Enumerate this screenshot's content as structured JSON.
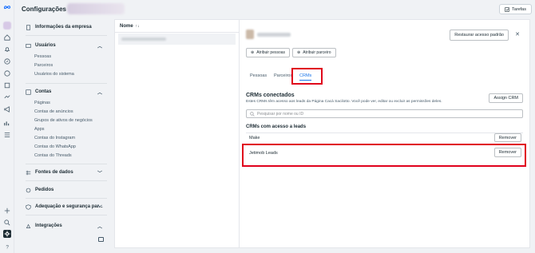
{
  "app": {
    "title": "Configurações"
  },
  "header": {
    "tasks_label": "Tarefas"
  },
  "sidebar": {
    "business_info": "Informações da empresa",
    "users": {
      "label": "Usuários",
      "items": [
        "Pessoas",
        "Parceiros",
        "Usuários do sistema"
      ]
    },
    "accounts": {
      "label": "Contas",
      "items": [
        "Páginas",
        "Contas de anúncios",
        "Grupos de ativos de negócios",
        "Apps",
        "Contas do Instagram",
        "Contas do WhatsApp",
        "Contas do Threads"
      ]
    },
    "data_sources": "Fontes de dados",
    "orders": "Pedidos",
    "brand_safety": "Adequação e segurança par...",
    "integrations": "Integrações"
  },
  "list": {
    "header": "Nome"
  },
  "detail": {
    "restore_label": "Restaurar acesso padrão",
    "close_glyph": "✕",
    "assign_people": "Atribuir pessoas",
    "assign_partner": "Atribuir parceiro",
    "tabs": [
      "Pessoas",
      "Parceiros",
      "CRMs"
    ],
    "crm_title": "CRMs conectados",
    "crm_desc": "Estes CRMs têm acesso aos leads da Página Cacá Sacilotto. Você pode ver, editar ou excluir as permissões deles.",
    "assign_crm": "Assign CRM",
    "search_placeholder": "Pesquisar por nome ou ID",
    "access_title": "CRMs com acesso a leads",
    "rows": [
      {
        "name": "Make",
        "action": "Remover"
      },
      {
        "name": "Jetimob Leads",
        "action": "Remover"
      }
    ]
  }
}
